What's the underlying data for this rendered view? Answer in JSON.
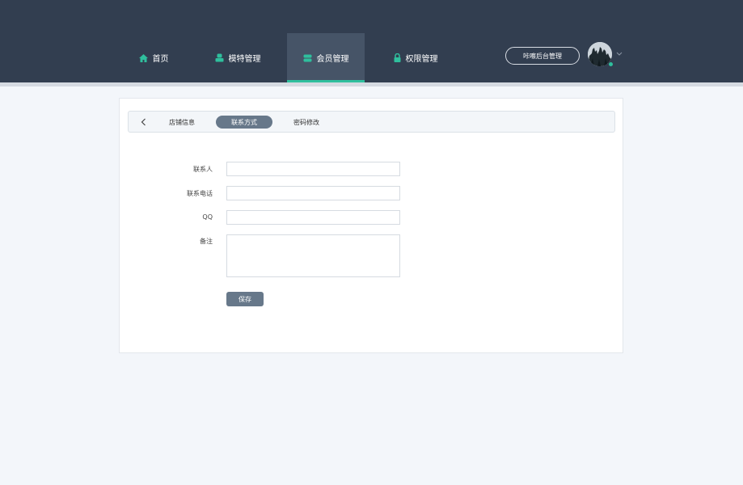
{
  "header": {
    "nav": [
      {
        "label": "首页",
        "icon": "home-icon",
        "active": false
      },
      {
        "label": "模特管理",
        "icon": "hat-icon",
        "active": false
      },
      {
        "label": "会员管理",
        "icon": "member-icon",
        "active": true
      },
      {
        "label": "权限管理",
        "icon": "lock-icon",
        "active": false
      }
    ],
    "admin_label": "咔嚓后台管理",
    "avatar": "avatar-image",
    "caret_icon": "chevron-down-icon"
  },
  "tabs": [
    {
      "label": "店铺信息",
      "active": false
    },
    {
      "label": "联系方式",
      "active": true
    },
    {
      "label": "密码修改",
      "active": false
    }
  ],
  "form": {
    "contact_label": "联系人",
    "contact_value": "",
    "phone_label": "联系电话",
    "phone_value": "",
    "qq_label": "QQ",
    "qq_value": "",
    "note_label": "备注",
    "note_value": "",
    "save_label": "保存"
  },
  "colors": {
    "header_bg": "#323e50",
    "accent": "#2fbf9d",
    "button": "#67788a"
  }
}
